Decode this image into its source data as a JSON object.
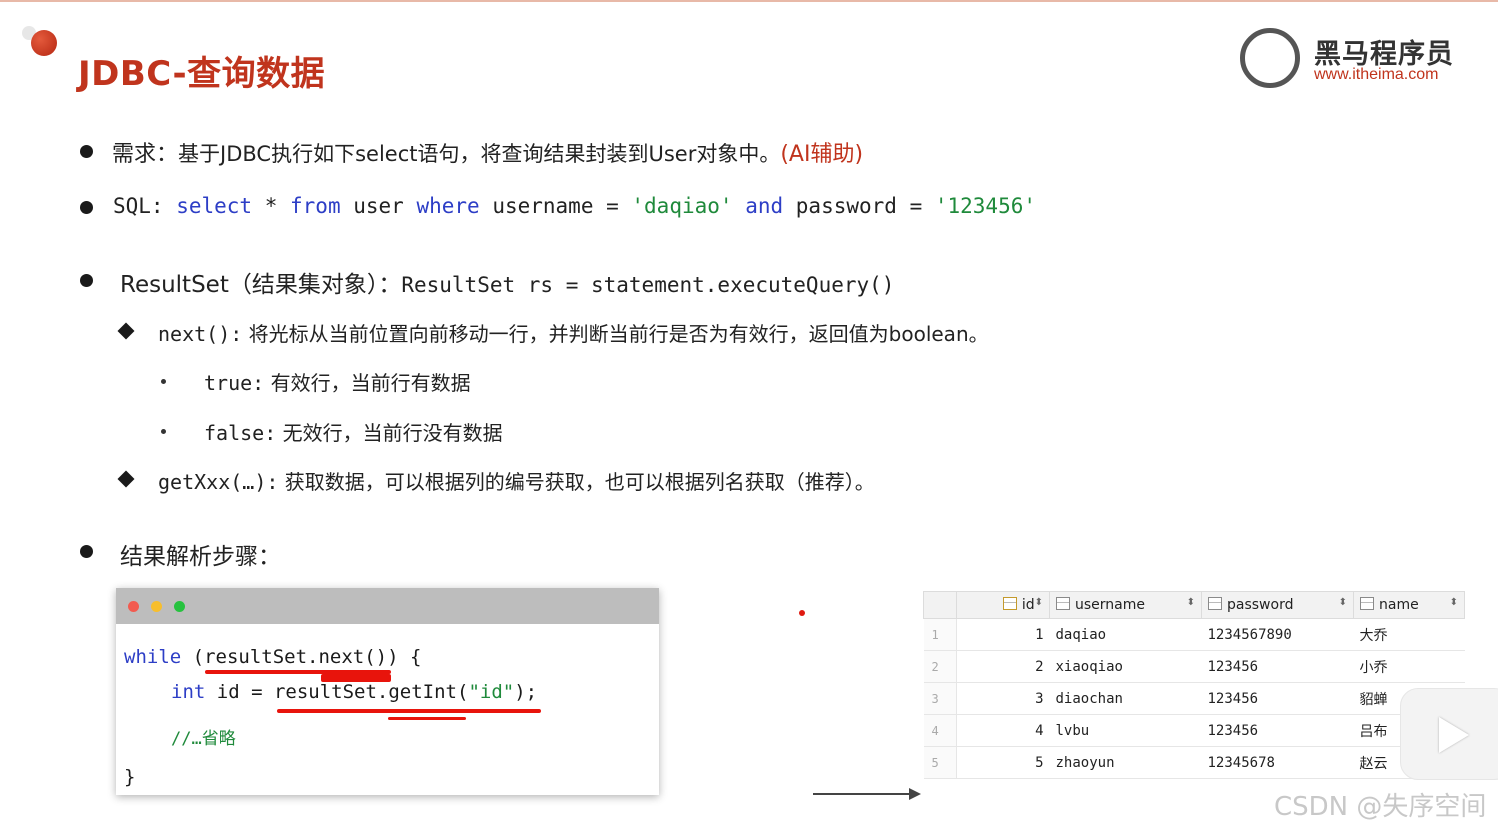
{
  "title": "JDBC-查询数据",
  "logo": {
    "name": "黑马程序员",
    "url": "www.itheima.com"
  },
  "req": {
    "label": "需求：",
    "text": "基于JDBC执行如下select语句，将查询结果封装到User对象中。",
    "hint": "(AI辅助)"
  },
  "sql": {
    "label": "SQL: ",
    "t1": "select",
    "t2": " * ",
    "t3": "from",
    "t4": " user ",
    "t5": "where",
    "t6": " username = ",
    "t7": "'daqiao'",
    "t8": " ",
    "t9": "and",
    "t10": " password = ",
    "t11": "'123456'"
  },
  "resultset": {
    "label": "ResultSet（结果集对象）：",
    "code": "ResultSet rs = statement.executeQuery()"
  },
  "next": {
    "code": "next():",
    "text": " 将光标从当前位置向前移动一行，并判断当前行是否为有效行，返回值为boolean。"
  },
  "true_item": {
    "code": "true:",
    "text": " 有效行，当前行有数据"
  },
  "false_item": {
    "code": "false:",
    "text": " 无效行，当前行没有数据"
  },
  "getxxx": {
    "code": "getXxx(…):",
    "text": " 获取数据，可以根据列的编号获取，也可以根据列名获取（推荐）。"
  },
  "steps": {
    "label": "结果解析步骤："
  },
  "code": {
    "l1_kw": "while",
    "l1_rest": " (resultSet.next()) {",
    "l2_kw": "int",
    "l2_rest": " id = resultSet.getInt(",
    "l2_str": "\"id\"",
    "l2_end": ");",
    "l3": "//…省略",
    "l4": "}"
  },
  "table": {
    "headers": [
      "id",
      "username",
      "password",
      "name"
    ],
    "rows": [
      [
        "1",
        "1",
        "daqiao",
        "1234567890",
        "大乔"
      ],
      [
        "2",
        "2",
        "xiaoqiao",
        "123456",
        "小乔"
      ],
      [
        "3",
        "3",
        "diaochan",
        "123456",
        "貂蝉"
      ],
      [
        "4",
        "4",
        "lvbu",
        "123456",
        "吕布"
      ],
      [
        "5",
        "5",
        "zhaoyun",
        "12345678",
        "赵云"
      ]
    ]
  },
  "watermark": "CSDN @失序空间",
  "colors": {
    "accent": "#c0341d",
    "keyword": "#2d3ec6",
    "string": "#1f8a3b",
    "annotation": "#e8140c"
  }
}
